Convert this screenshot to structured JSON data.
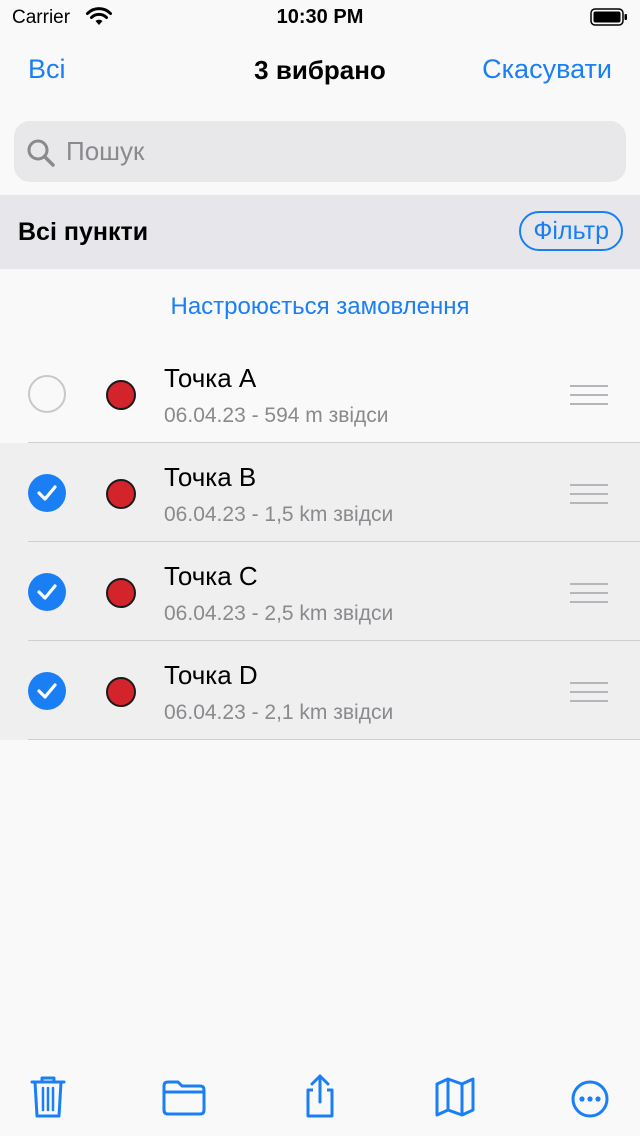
{
  "status": {
    "carrier": "Carrier",
    "time": "10:30 PM"
  },
  "nav": {
    "left": "Всі",
    "title": "3 вибрано",
    "right": "Скасувати"
  },
  "search": {
    "placeholder": "Пошук",
    "value": ""
  },
  "section": {
    "title": "Всі пункти",
    "filter": "Фільтр"
  },
  "order_link": "Настроюється замовлення",
  "accent": "#1a7ff5",
  "marker_color": "#d3242c",
  "items": [
    {
      "title": "Точка A",
      "subtitle": "06.04.23 - 594 m звідси",
      "selected": false
    },
    {
      "title": "Точка B",
      "subtitle": "06.04.23 - 1,5 km звідси",
      "selected": true
    },
    {
      "title": "Точка C",
      "subtitle": "06.04.23 - 2,5 km звідси",
      "selected": true
    },
    {
      "title": "Точка D",
      "subtitle": "06.04.23 - 2,1 km звідси",
      "selected": true
    }
  ],
  "toolbar": {
    "icons": [
      "trash-icon",
      "folder-icon",
      "share-icon",
      "map-icon",
      "more-icon"
    ]
  }
}
